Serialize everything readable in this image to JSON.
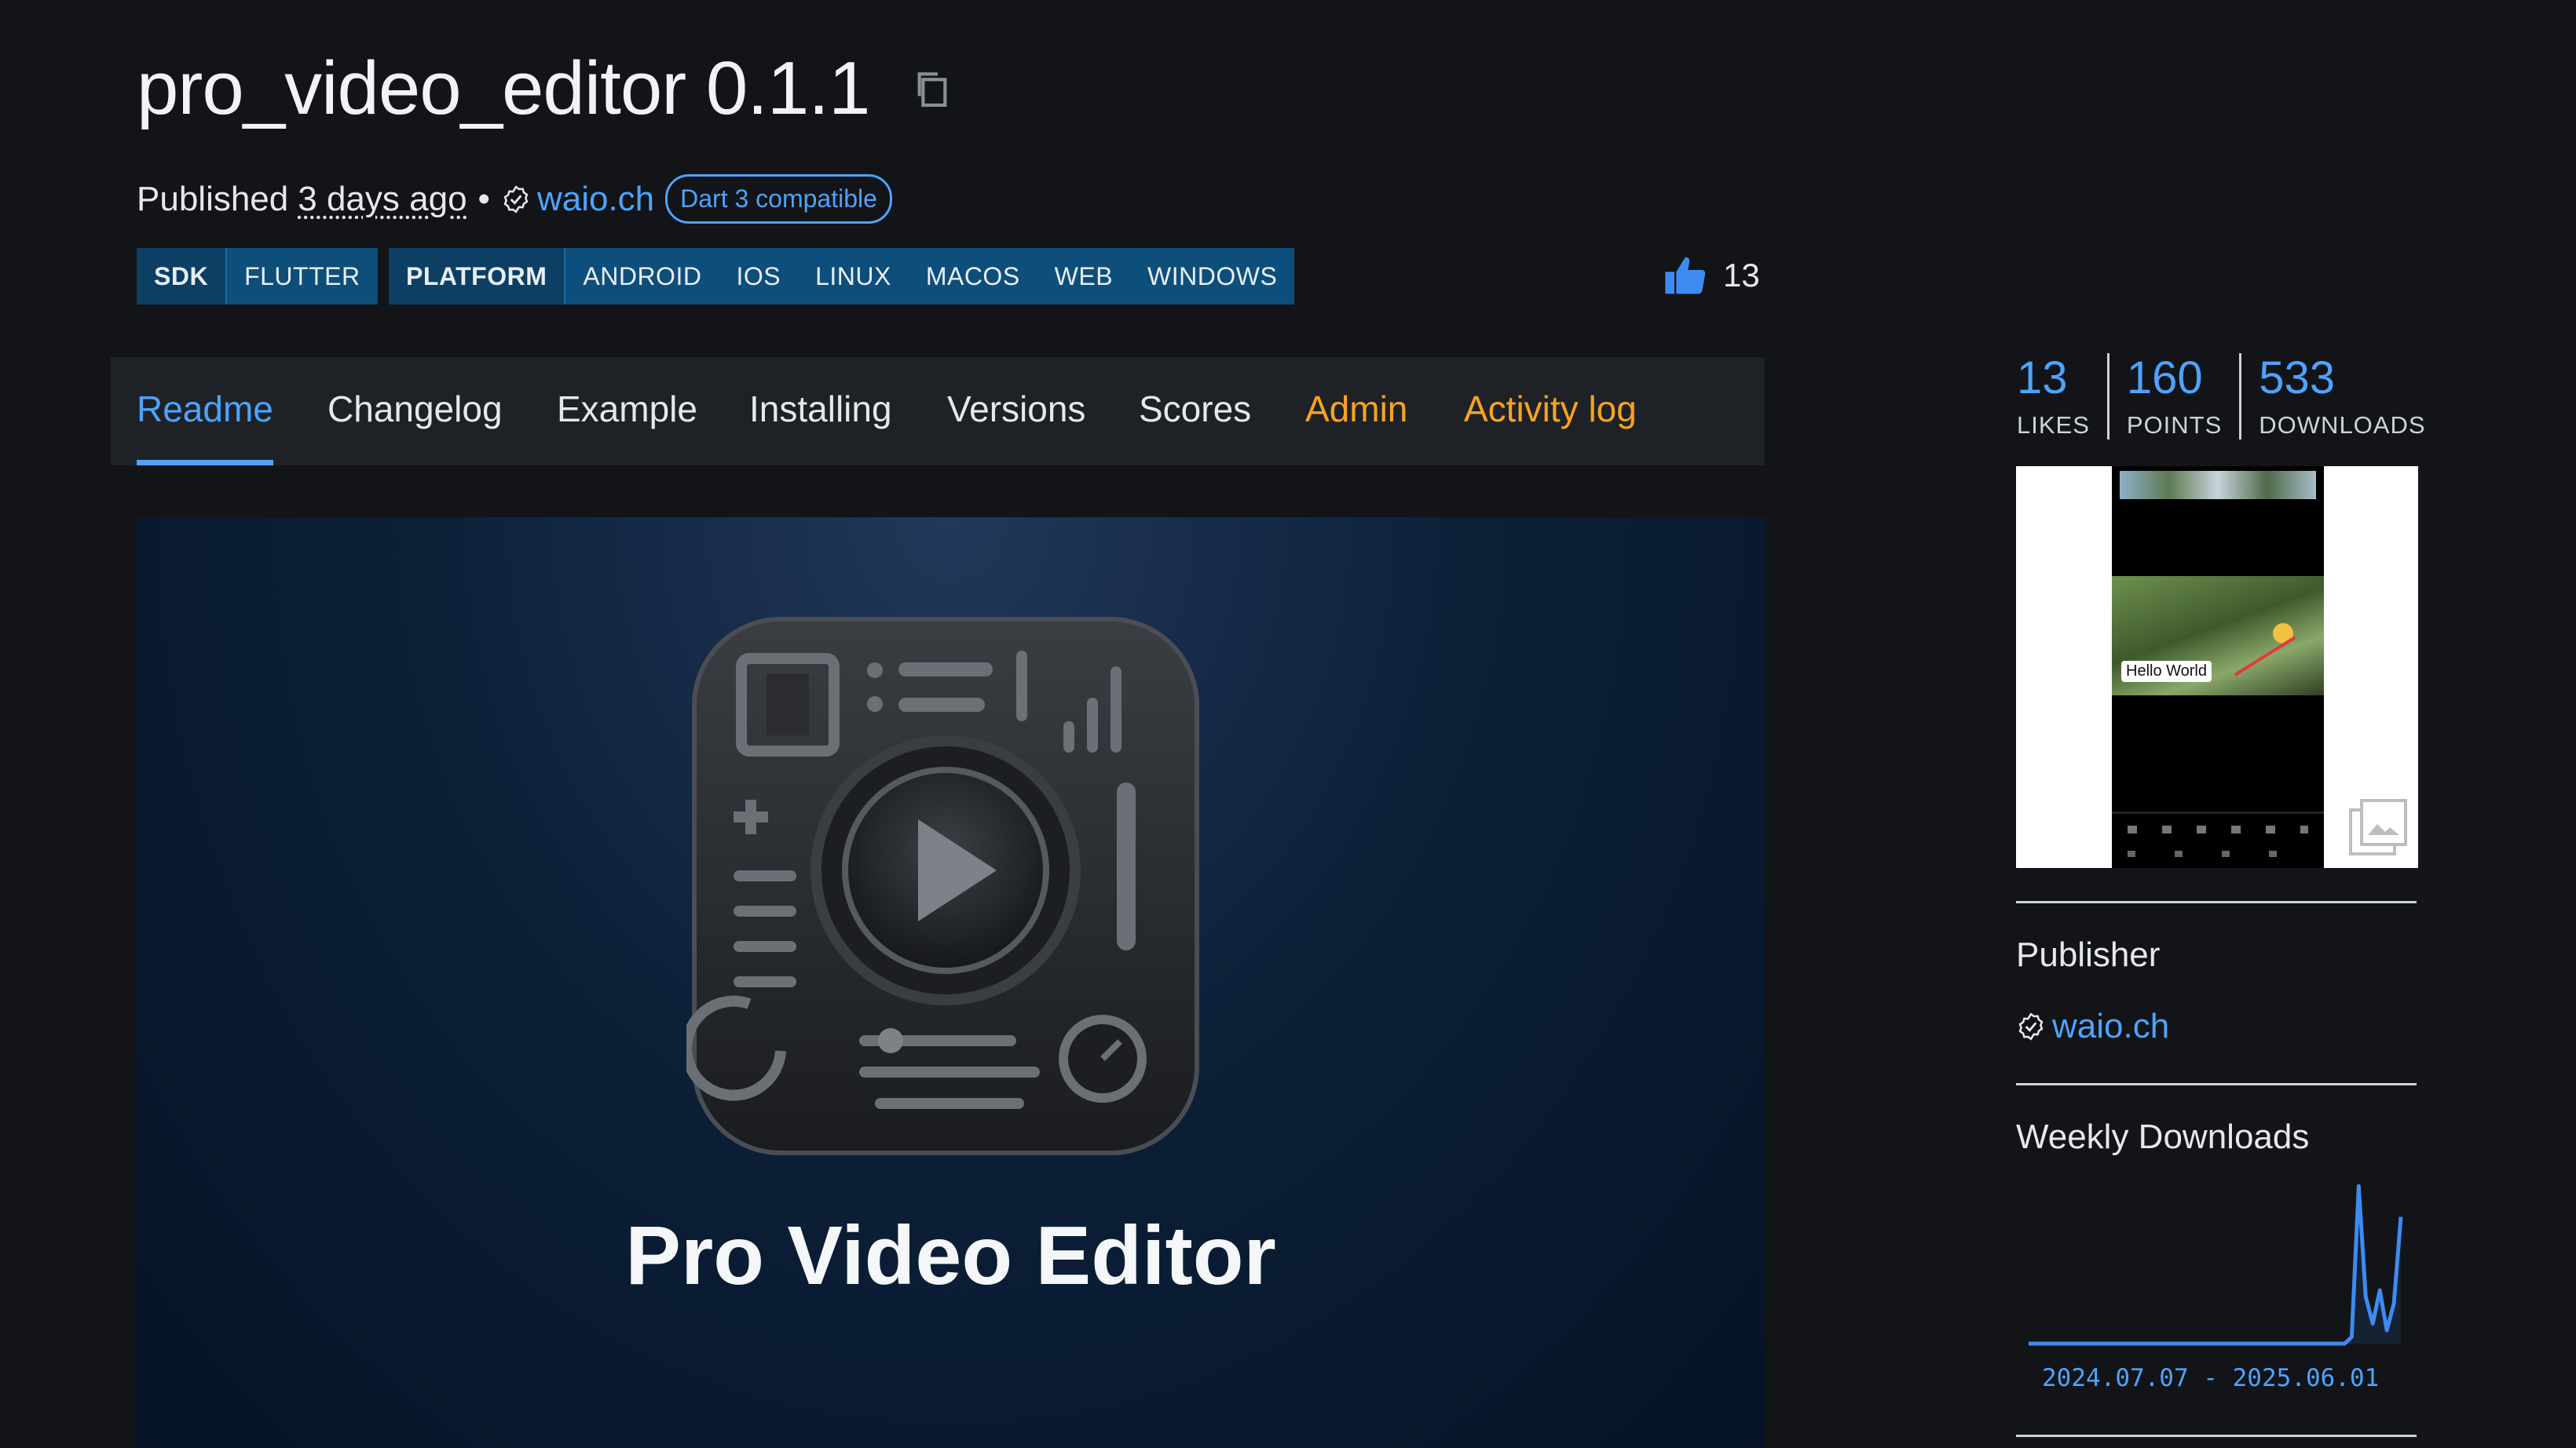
{
  "package": {
    "title": "pro_video_editor 0.1.1",
    "published_prefix": "Published",
    "published_time": "3 days ago",
    "bullet": "•",
    "publisher": "waio.ch",
    "compat_badge": "Dart 3 compatible"
  },
  "tags": {
    "sdk_head": "SDK",
    "sdk": [
      "FLUTTER"
    ],
    "platform_head": "PLATFORM",
    "platforms": [
      "ANDROID",
      "IOS",
      "LINUX",
      "MACOS",
      "WEB",
      "WINDOWS"
    ]
  },
  "likes_count": "13",
  "tabs": [
    "Readme",
    "Changelog",
    "Example",
    "Installing",
    "Versions",
    "Scores",
    "Admin",
    "Activity log"
  ],
  "banner": {
    "title": "Pro Video Editor"
  },
  "stats": [
    {
      "value": "13",
      "label": "LIKES"
    },
    {
      "value": "160",
      "label": "POINTS"
    },
    {
      "value": "533",
      "label": "DOWNLOADS"
    }
  ],
  "preview": {
    "caption": "Hello World"
  },
  "sidebar": {
    "publisher_heading": "Publisher",
    "publisher_name": "waio.ch",
    "downloads_heading": "Weekly Downloads",
    "date_range": "2024.07.07 - 2025.06.01"
  },
  "colors": {
    "accent": "#4da3ff",
    "admin": "#f7a320",
    "background": "#121417",
    "tag": "#0e4e7a"
  },
  "chart_data": {
    "type": "line",
    "title": "Weekly Downloads",
    "x_range": [
      "2024.07.07",
      "2025.06.01"
    ],
    "values": [
      0,
      0,
      0,
      0,
      0,
      0,
      0,
      0,
      0,
      0,
      0,
      0,
      0,
      0,
      0,
      0,
      0,
      0,
      0,
      0,
      0,
      0,
      0,
      0,
      0,
      0,
      0,
      0,
      0,
      0,
      0,
      0,
      0,
      0,
      0,
      0,
      0,
      0,
      0,
      0,
      0,
      0,
      0,
      0,
      0,
      0,
      5,
      118,
      35,
      15,
      40,
      10,
      30,
      95
    ],
    "ylim": [
      0,
      120
    ]
  }
}
